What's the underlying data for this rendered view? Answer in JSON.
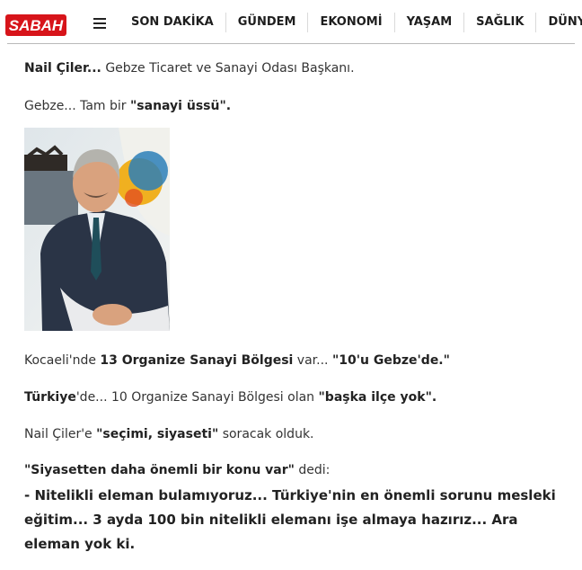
{
  "header": {
    "logo_text": "SABAH",
    "nav": [
      "SON DAKİKA",
      "GÜNDEM",
      "EKONOMİ",
      "YAŞAM",
      "SAĞLIK",
      "DÜNYA"
    ]
  },
  "article": {
    "p1": {
      "a": "Nail Çiler...",
      "b": " Gebze Ticaret ve Sanayi Odası Başkanı."
    },
    "p2": {
      "a": "Gebze... Tam bir ",
      "b": "\"sanayi üssü\"."
    },
    "photo": {
      "alt": "Nail Çiler",
      "icon": "portrait-photo"
    },
    "p3": {
      "a": "Kocaeli'nde ",
      "b": "13 Organize Sanayi Bölgesi",
      "c": " var... ",
      "d": "\"10'u Gebze'de.\""
    },
    "p4": {
      "a": "Türkiye",
      "b": "'de... 10 Organize Sanayi Bölgesi olan ",
      "c": "\"başka ilçe yok\"."
    },
    "p5": {
      "a": "Nail Çiler'e ",
      "b": "\"seçimi, siyaseti\"",
      "c": " soracak olduk."
    },
    "p6": {
      "a": "\"Siyasetten daha önemli bir konu var\"",
      "b": " dedi:"
    },
    "p7": "- Nitelikli eleman bulamıyoruz... Türkiye'nin en önemli sorunu mesleki eğitim... 3 ayda 100 bin nitelikli elemanı işe almaya hazırız... Ara eleman yok ki."
  },
  "colors": {
    "brand": "#d7141a"
  }
}
